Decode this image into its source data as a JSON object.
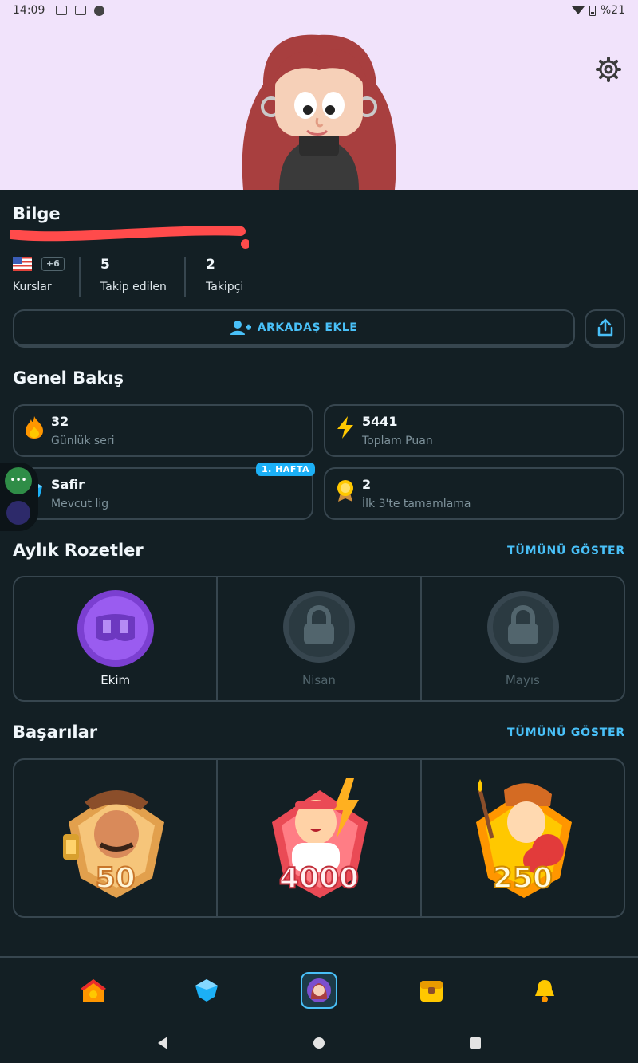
{
  "status_bar": {
    "time": "14:09",
    "battery": "%21"
  },
  "profile": {
    "name": "Bilge"
  },
  "stats": [
    {
      "value": "",
      "label": "Kurslar",
      "extra": "+6"
    },
    {
      "value": "5",
      "label": "Takip edilen"
    },
    {
      "value": "2",
      "label": "Takipçi"
    }
  ],
  "actions": {
    "add_friend": "ARKADAŞ EKLE"
  },
  "overview": {
    "title": "Genel Bakış",
    "cards": [
      {
        "value": "32",
        "label": "Günlük seri",
        "icon": "fire-icon"
      },
      {
        "value": "5441",
        "label": "Toplam Puan",
        "icon": "lightning-icon"
      },
      {
        "value": "Safir",
        "label": "Mevcut lig",
        "icon": "sapphire-league-icon",
        "badge": "1. HAFTA"
      },
      {
        "value": "2",
        "label": "İlk 3'te tamamlama",
        "icon": "medal-icon"
      }
    ]
  },
  "monthly_badges": {
    "title": "Aylık Rozetler",
    "show_all": "TÜMÜNÜ GÖSTER",
    "items": [
      {
        "label": "Ekim",
        "locked": false
      },
      {
        "label": "Nisan",
        "locked": true
      },
      {
        "label": "Mayıs",
        "locked": true
      }
    ]
  },
  "achievements": {
    "title": "Başarılar",
    "show_all": "TÜMÜNÜ GÖSTER",
    "items": [
      {
        "value": "50",
        "icon": "explorer-achievement-icon"
      },
      {
        "value": "4000",
        "icon": "sage-achievement-icon"
      },
      {
        "value": "250",
        "icon": "scholar-achievement-icon"
      }
    ]
  },
  "bottom_nav": [
    "home-icon",
    "leagues-icon",
    "profile-icon",
    "shop-icon",
    "notifications-icon"
  ],
  "colors": {
    "accent": "#49c0f8",
    "background": "#131f24",
    "header_bg": "#f1e3fb",
    "border": "#37464f"
  }
}
